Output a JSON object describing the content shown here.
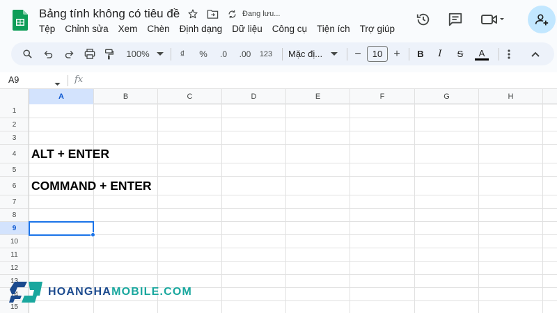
{
  "document": {
    "title": "Bảng tính không có tiêu đề",
    "save_status": "Đang lưu..."
  },
  "menu": [
    "Tệp",
    "Chỉnh sửa",
    "Xem",
    "Chèn",
    "Định dạng",
    "Dữ liệu",
    "Công cụ",
    "Tiện ích",
    "Trợ giúp"
  ],
  "toolbar": {
    "zoom": "100%",
    "currency": "₫",
    "percent": "%",
    "decrease_decimal": ".0",
    "increase_decimal": ".00",
    "number_format": "123",
    "font": "Mặc đị...",
    "font_size": "10",
    "minus": "−",
    "plus": "+",
    "bold": "B",
    "italic": "I",
    "strikethrough": "S",
    "text_color": "A"
  },
  "formula_bar": {
    "name_box": "A9",
    "fx": "fx"
  },
  "grid": {
    "columns": [
      "A",
      "B",
      "C",
      "D",
      "E",
      "F",
      "G",
      "H"
    ],
    "rows": [
      "1",
      "2",
      "3",
      "4",
      "5",
      "6",
      "7",
      "8",
      "9",
      "10",
      "11",
      "12",
      "13",
      "14",
      "15"
    ],
    "cells": {
      "A4": "ALT + ENTER",
      "A6": "COMMAND + ENTER"
    },
    "selected": "A9"
  },
  "watermark": {
    "part1": "HOANGHA",
    "part2": "MOBILE.COM"
  },
  "colors": {
    "accent": "#1a73e8",
    "sheets_green": "#0f9d58",
    "toolbar_bg": "#edf2fa",
    "share_bg": "#c2e7ff"
  }
}
